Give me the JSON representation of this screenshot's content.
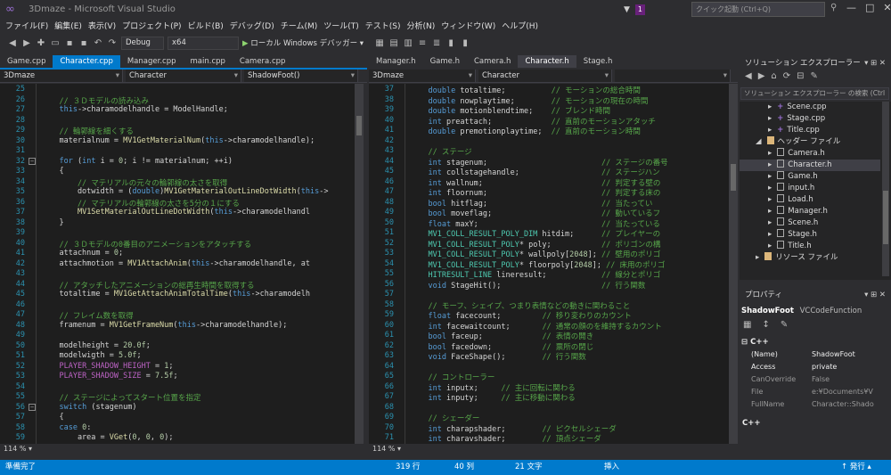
{
  "window": {
    "title": "3Dmaze - Microsoft Visual Studio",
    "notification_count": "1",
    "quick_launch_placeholder": "クイック起動 (Ctrl+Q)"
  },
  "menu": [
    "ファイル(F)",
    "編集(E)",
    "表示(V)",
    "プロジェクト(P)",
    "ビルド(B)",
    "デバッグ(D)",
    "チーム(M)",
    "ツール(T)",
    "テスト(S)",
    "分析(N)",
    "ウィンドウ(W)",
    "ヘルプ(H)"
  ],
  "toolbar": {
    "config": "Debug",
    "platform": "x64",
    "run_label": "ローカル Windows デバッガー"
  },
  "left_editor": {
    "tabs": [
      "Game.cpp",
      "Character.cpp",
      "Manager.cpp",
      "main.cpp",
      "Camera.cpp"
    ],
    "nav": [
      "3Dmaze",
      "Character",
      "ShadowFoot()"
    ],
    "zoom": "114 %",
    "lines": [
      {
        "n": "25",
        "t": ""
      },
      {
        "n": "26",
        "t": "    // ３Ｄモデルの読み込み",
        "c": "cm"
      },
      {
        "n": "27",
        "t": "    this->charamodelhandle = ModelHandle;"
      },
      {
        "n": "28",
        "t": ""
      },
      {
        "n": "29",
        "t": "    // 輪郭線を細くする",
        "c": "cm"
      },
      {
        "n": "30",
        "t": "    materialnum = MV1GetMaterialNum(this->charamodelhandle);"
      },
      {
        "n": "31",
        "t": ""
      },
      {
        "n": "32",
        "t": "    for (int i = 0; i != materialnum; ++i)"
      },
      {
        "n": "33",
        "t": "    {"
      },
      {
        "n": "34",
        "t": "        // マテリアルの元々の輪郭線の太さを取得",
        "c": "cm"
      },
      {
        "n": "35",
        "t": "        dotwidth = (double)MV1GetMaterialOutLineDotWidth(this->"
      },
      {
        "n": "36",
        "t": "        // マテリアルの輪郭線の太さを5分の１にする",
        "c": "cm"
      },
      {
        "n": "37",
        "t": "        MV1SetMaterialOutLineDotWidth(this->charamodelhandl"
      },
      {
        "n": "38",
        "t": "    }"
      },
      {
        "n": "39",
        "t": ""
      },
      {
        "n": "40",
        "t": "    // ３Ｄモデルの0番目のアニメーションをアタッチする",
        "c": "cm"
      },
      {
        "n": "41",
        "t": "    attachnum = 0;"
      },
      {
        "n": "42",
        "t": "    attachmotion = MV1AttachAnim(this->charamodelhandle, at"
      },
      {
        "n": "43",
        "t": ""
      },
      {
        "n": "44",
        "t": "    // アタッチしたアニメーションの総再生時間を取得する",
        "c": "cm"
      },
      {
        "n": "45",
        "t": "    totaltime = MV1GetAttachAnimTotalTime(this->charamodelh"
      },
      {
        "n": "46",
        "t": ""
      },
      {
        "n": "47",
        "t": "    // フレイム数を取得",
        "c": "cm"
      },
      {
        "n": "48",
        "t": "    framenum = MV1GetFrameNum(this->charamodelhandle);"
      },
      {
        "n": "49",
        "t": ""
      },
      {
        "n": "50",
        "t": "    modelheight = 20.0f;"
      },
      {
        "n": "51",
        "t": "    modelwigth = 5.0f;"
      },
      {
        "n": "52",
        "t": "    PLAYER_SHADOW_HEIGHT = 1;"
      },
      {
        "n": "53",
        "t": "    PLAYER_SHADOW_SIZE = 7.5f;"
      },
      {
        "n": "54",
        "t": ""
      },
      {
        "n": "55",
        "t": "    // ステージによってスタート位置を指定",
        "c": "cm"
      },
      {
        "n": "56",
        "t": "    switch (stagenum)"
      },
      {
        "n": "57",
        "t": "    {"
      },
      {
        "n": "58",
        "t": "    case 0:"
      },
      {
        "n": "59",
        "t": "        area = VGet(0, 0, 0);"
      }
    ]
  },
  "right_editor": {
    "tabs": [
      "Manager.h",
      "Game.h",
      "Camera.h",
      "Character.h",
      "Stage.h"
    ],
    "nav": [
      "3Dmaze",
      "Character"
    ],
    "zoom": "114 %",
    "lines": [
      {
        "n": "37",
        "t": "    double totaltime;          // モーションの総合時間"
      },
      {
        "n": "38",
        "t": "    double nowplaytime;        // モーションの現在の時間"
      },
      {
        "n": "39",
        "t": "    double motionblendtime;    // ブレンド時間"
      },
      {
        "n": "40",
        "t": "    int preattach;             // 直前のモーションアタッチ"
      },
      {
        "n": "41",
        "t": "    double premotionplaytime;  // 直前のモーション時間"
      },
      {
        "n": "42",
        "t": ""
      },
      {
        "n": "43",
        "t": "    // ステージ",
        "c": "cm"
      },
      {
        "n": "44",
        "t": "    int stagenum;                         // ステージの番号"
      },
      {
        "n": "45",
        "t": "    int collstagehandle;                  // ステージハン"
      },
      {
        "n": "46",
        "t": "    int wallnum;                          // 判定する壁の"
      },
      {
        "n": "47",
        "t": "    int floornum;                         // 判定する床の"
      },
      {
        "n": "48",
        "t": "    bool hitflag;                         // 当たってい"
      },
      {
        "n": "49",
        "t": "    bool moveflag;                        // 動いているフ"
      },
      {
        "n": "50",
        "t": "    float maxY;                           // 当たっている"
      },
      {
        "n": "51",
        "t": "    MV1_COLL_RESULT_POLY_DIM hitdim;      // プレイヤーの"
      },
      {
        "n": "52",
        "t": "    MV1_COLL_RESULT_POLY* poly;           // ポリゴンの構"
      },
      {
        "n": "53",
        "t": "    MV1_COLL_RESULT_POLY* wallpoly[2048]; // 壁用のポリゴ"
      },
      {
        "n": "54",
        "t": "    MV1_COLL_RESULT_POLY* floorpoly[2048]; // 床用のポリゴ"
      },
      {
        "n": "55",
        "t": "    HITRESULT_LINE lineresult;            // 線分とポリゴ"
      },
      {
        "n": "56",
        "t": "    void StageHit();                      // 行う関数"
      },
      {
        "n": "57",
        "t": ""
      },
      {
        "n": "58",
        "t": "    // モーフ、シェイプ、つまり表情などの動きに関わること",
        "c": "cm"
      },
      {
        "n": "59",
        "t": "    float facecount;         // 移り変わりのカウント"
      },
      {
        "n": "60",
        "t": "    int facewaitcount;       // 通常の顔のを維持するカウント"
      },
      {
        "n": "61",
        "t": "    bool faceup;             // 表情の開き"
      },
      {
        "n": "62",
        "t": "    bool facedown;           // 票所の閉じ"
      },
      {
        "n": "63",
        "t": "    void FaceShape();        // 行う関数"
      },
      {
        "n": "64",
        "t": ""
      },
      {
        "n": "65",
        "t": "    // コントローラー",
        "c": "cm"
      },
      {
        "n": "66",
        "t": "    int inputx;     // 主に回転に関わる"
      },
      {
        "n": "67",
        "t": "    int inputy;     // 主に移動に関わる"
      },
      {
        "n": "68",
        "t": ""
      },
      {
        "n": "69",
        "t": "    // シェーダー",
        "c": "cm"
      },
      {
        "n": "70",
        "t": "    int charapshader;        // ピクセルシェーダ"
      },
      {
        "n": "71",
        "t": "    int charavshader;        // 頂点シェーダ"
      }
    ]
  },
  "solution_explorer": {
    "title": "ソリューション エクスプローラー",
    "search_placeholder": "ソリューション エクスプローラー の検索 (Ctrl",
    "items": [
      {
        "label": "Scene.cpp",
        "kind": "cpp",
        "indent": 2
      },
      {
        "label": "Stage.cpp",
        "kind": "cpp",
        "indent": 2
      },
      {
        "label": "Title.cpp",
        "kind": "cpp",
        "indent": 2
      },
      {
        "label": "ヘッダー ファイル",
        "kind": "folder",
        "indent": 1
      },
      {
        "label": "Camera.h",
        "kind": "h",
        "indent": 2
      },
      {
        "label": "Character.h",
        "kind": "h",
        "indent": 2,
        "selected": true
      },
      {
        "label": "Game.h",
        "kind": "h",
        "indent": 2
      },
      {
        "label": "input.h",
        "kind": "h",
        "indent": 2
      },
      {
        "label": "Load.h",
        "kind": "h",
        "indent": 2
      },
      {
        "label": "Manager.h",
        "kind": "h",
        "indent": 2
      },
      {
        "label": "Scene.h",
        "kind": "h",
        "indent": 2
      },
      {
        "label": "Stage.h",
        "kind": "h",
        "indent": 2
      },
      {
        "label": "Title.h",
        "kind": "h",
        "indent": 2
      },
      {
        "label": "リソース ファイル",
        "kind": "folder",
        "indent": 1
      }
    ]
  },
  "properties": {
    "title": "プロパティ",
    "object": "ShadowFoot",
    "object_type": "VCCodeFunction",
    "category": "C++",
    "rows": [
      {
        "k": "(Name)",
        "v": "ShadowFoot",
        "strong": true
      },
      {
        "k": "Access",
        "v": "private",
        "strong": true
      },
      {
        "k": "CanOverride",
        "v": "False"
      },
      {
        "k": "File",
        "v": "e:¥Documents¥V"
      },
      {
        "k": "FullName",
        "v": "Character::Shado"
      }
    ],
    "footer": "C++"
  },
  "status": {
    "ready": "準備完了",
    "line": "319 行",
    "col": "40 列",
    "ch": "21 文字",
    "mode": "挿入",
    "publish": "発行"
  }
}
